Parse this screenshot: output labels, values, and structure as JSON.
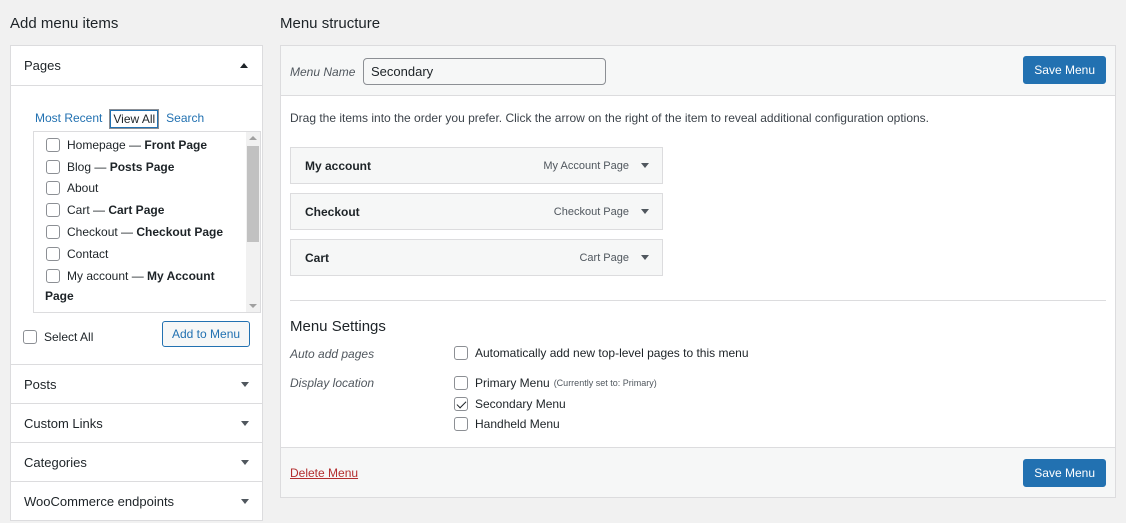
{
  "left": {
    "title": "Add menu items",
    "pages_section": {
      "label": "Pages",
      "tabs": [
        "Most Recent",
        "View All",
        "Search"
      ],
      "items": [
        {
          "name": "Homepage",
          "suffix": "Front Page",
          "checked": false
        },
        {
          "name": "Blog",
          "suffix": "Posts Page",
          "checked": false
        },
        {
          "name": "About",
          "suffix": "",
          "checked": false
        },
        {
          "name": "Cart",
          "suffix": "Cart Page",
          "checked": false
        },
        {
          "name": "Checkout",
          "suffix": "Checkout Page",
          "checked": false
        },
        {
          "name": "Contact",
          "suffix": "",
          "checked": false
        },
        {
          "name": "My account",
          "suffix": "My Account",
          "checked": false
        }
      ],
      "overflow_text": "Page",
      "select_all": "Select All",
      "add_button": "Add to Menu"
    },
    "sections": [
      "Posts",
      "Custom Links",
      "Categories",
      "WooCommerce endpoints"
    ]
  },
  "right": {
    "title": "Menu structure",
    "menu_name_label": "Menu Name",
    "menu_name_value": "Secondary",
    "save_label": "Save Menu",
    "instructions": "Drag the items into the order you prefer. Click the arrow on the right of the item to reveal additional configuration options.",
    "menu_items": [
      {
        "name": "My account",
        "type": "My Account Page"
      },
      {
        "name": "Checkout",
        "type": "Checkout Page"
      },
      {
        "name": "Cart",
        "type": "Cart Page"
      }
    ],
    "settings": {
      "title": "Menu Settings",
      "auto_add_label": "Auto add pages",
      "auto_add_text": "Automatically add new top-level pages to this menu",
      "display_location_label": "Display location",
      "locations": [
        {
          "name": "Primary Menu",
          "note": "(Currently set to: Primary)",
          "checked": false
        },
        {
          "name": "Secondary Menu",
          "note": "",
          "checked": true
        },
        {
          "name": "Handheld Menu",
          "note": "",
          "checked": false
        }
      ]
    },
    "delete_label": "Delete Menu"
  },
  "colors": {
    "accent": "#2271b1",
    "delete": "#b32d2e",
    "background": "#f1f1f1"
  }
}
